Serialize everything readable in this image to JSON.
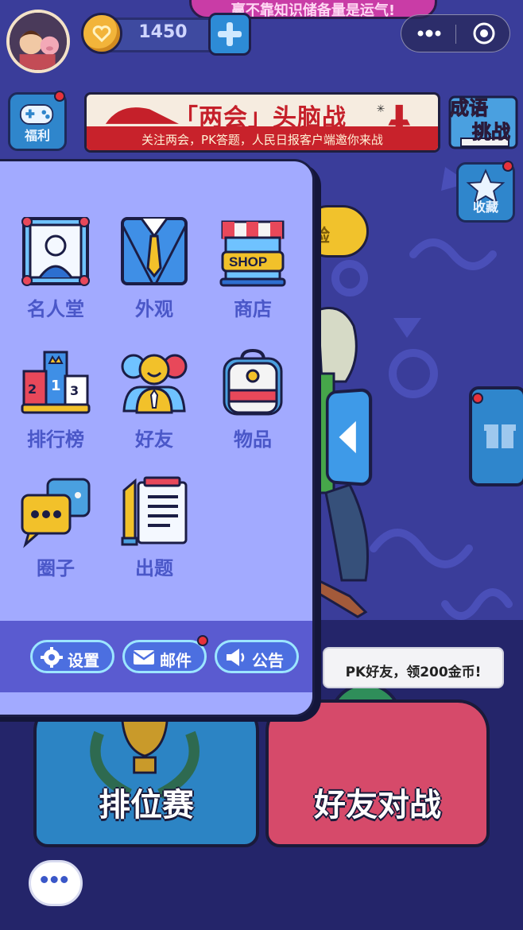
{
  "header": {
    "marquee_text": "赢不靠知识储备量是运气!",
    "coins": "1450",
    "capsule": {
      "more_icon": "more-dots-icon",
      "close_icon": "target-close-icon"
    }
  },
  "side": {
    "welfare_label": "福利",
    "collect_label": "收藏",
    "idiom_line1": "成语",
    "idiom_line2": "挑战",
    "hidden_button_label": "验"
  },
  "banner": {
    "title": "「两会」头脑战",
    "subtitle": "关注两会，PK答题，人民日报客户端邀你来战"
  },
  "menu": {
    "items": [
      {
        "label": "名人堂",
        "icon": "hall-of-fame-icon"
      },
      {
        "label": "外观",
        "icon": "suit-icon"
      },
      {
        "label": "商店",
        "icon": "shop-icon",
        "icon_text": "SHOP"
      },
      {
        "label": "排行榜",
        "icon": "podium-icon"
      },
      {
        "label": "好友",
        "icon": "friends-icon"
      },
      {
        "label": "物品",
        "icon": "backpack-icon"
      },
      {
        "label": "圈子",
        "icon": "chat-bubbles-icon"
      },
      {
        "label": "出题",
        "icon": "notepad-icon"
      }
    ],
    "footer": {
      "settings": "设置",
      "mail": "邮件",
      "notice": "公告"
    }
  },
  "bottom": {
    "rank_label": "排位赛",
    "friend_battle_label": "好友对战",
    "pk_tip": "PK好友，领200金币!"
  },
  "colors": {
    "panel": "#a2aaff",
    "footer": "#5a5bd0",
    "accent_blue": "#2f86cc",
    "notify_red": "#e8323a"
  }
}
